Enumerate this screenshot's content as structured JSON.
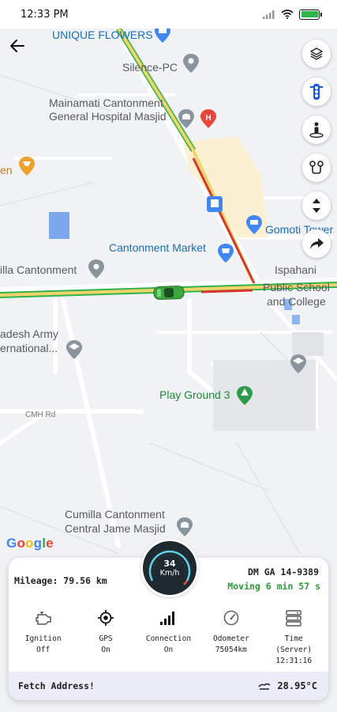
{
  "status_bar": {
    "time": "12:33 PM"
  },
  "map": {
    "labels": {
      "unique_flowers": "UNIQUE FLOWERS",
      "silence_pc": "Silence-PC",
      "hospital_line1": "Mainamati Cantonment",
      "hospital_line2": "General Hospital Masjid",
      "en": "en",
      "gomoti": "Gomoti Tower",
      "cantonment_market": "Cantonment Market",
      "cumilla_cantonment": "illa Cantonment",
      "ispahani_line1": "Ispahani",
      "ispahani_line2": "Public School",
      "ispahani_line3": "and College",
      "bangladesh_army_line1": "adesh Army",
      "bangladesh_army_line2": "ernational...",
      "play_ground": "Play Ground 3",
      "cmh_rd": "CMH Rd",
      "jame_masjid_line1": "Cumilla Cantonment",
      "jame_masjid_line2": "Central Jame Masjid"
    },
    "google_logo": "Google"
  },
  "controls": {
    "back": "back",
    "layers_icon": "layers-icon",
    "traffic_icon": "traffic-light-icon",
    "street_view_icon": "street-view-icon",
    "route_icon": "route-icon",
    "expand_icon": "expand-vertical-icon",
    "navigate_icon": "share-arrow-icon"
  },
  "info_card": {
    "mileage": "Mileage: 79.56 km",
    "plate": "DM GA 14-9389",
    "moving": "Moving 6 min 57 s",
    "speed_value": "34",
    "speed_unit": "Km/h",
    "stats": [
      {
        "line1": "Ignition",
        "line2": "Off",
        "icon": "engine-icon"
      },
      {
        "line1": "GPS",
        "line2": "On",
        "icon": "gps-icon"
      },
      {
        "line1": "Connection",
        "line2": "On",
        "icon": "signal-icon"
      },
      {
        "line1": "Odometer",
        "line2": "75054km",
        "icon": "gauge-icon"
      },
      {
        "line1": "Time",
        "line2": "(Server)",
        "line3": "12:31:16",
        "icon": "server-icon"
      }
    ],
    "fetch_address": "Fetch Address!",
    "temperature": "28.95°C"
  },
  "colors": {
    "route_green": "#2fb34a",
    "route_yellow": "#f3d36b",
    "route_red": "#d9362b",
    "moving_green": "#2e9b3a",
    "footer_bg": "#ebecf7",
    "label_blue": "#1a6fb8"
  }
}
